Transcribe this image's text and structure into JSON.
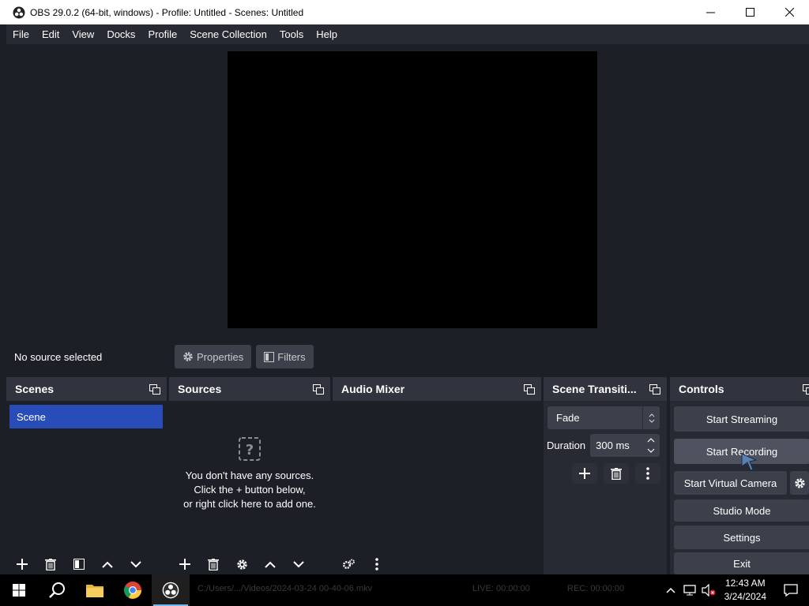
{
  "window": {
    "title": "OBS 29.0.2 (64-bit, windows) - Profile: Untitled - Scenes: Untitled"
  },
  "menu": [
    "File",
    "Edit",
    "View",
    "Docks",
    "Profile",
    "Scene Collection",
    "Tools",
    "Help"
  ],
  "source_bar": {
    "status": "No source selected",
    "properties_label": "Properties",
    "filters_label": "Filters"
  },
  "docks": {
    "scenes": {
      "title": "Scenes",
      "items": [
        "Scene"
      ]
    },
    "sources": {
      "title": "Sources",
      "empty_line1": "You don't have any sources.",
      "empty_line2": "Click the + button below,",
      "empty_line3": "or right click here to add one."
    },
    "audio": {
      "title": "Audio Mixer"
    },
    "transitions": {
      "title": "Scene Transiti...",
      "selected": "Fade",
      "duration_label": "Duration",
      "duration_value": "300 ms"
    },
    "controls": {
      "title": "Controls",
      "start_streaming": "Start Streaming",
      "start_recording": "Start Recording",
      "start_virtual_camera": "Start Virtual Camera",
      "studio_mode": "Studio Mode",
      "settings": "Settings",
      "exit": "Exit"
    }
  },
  "taskbar": {
    "status_path": "C:/Users/.../Videos/2024-03-24 00-40-06.mkv",
    "live": "LIVE: 00:00:00",
    "rec": "REC: 00:00:00",
    "time": "12:43 AM",
    "date": "3/24/2024"
  },
  "colors": {
    "accent": "#284cb8",
    "panel": "#272a33",
    "background": "#1d1f26",
    "button": "#3c404b"
  }
}
